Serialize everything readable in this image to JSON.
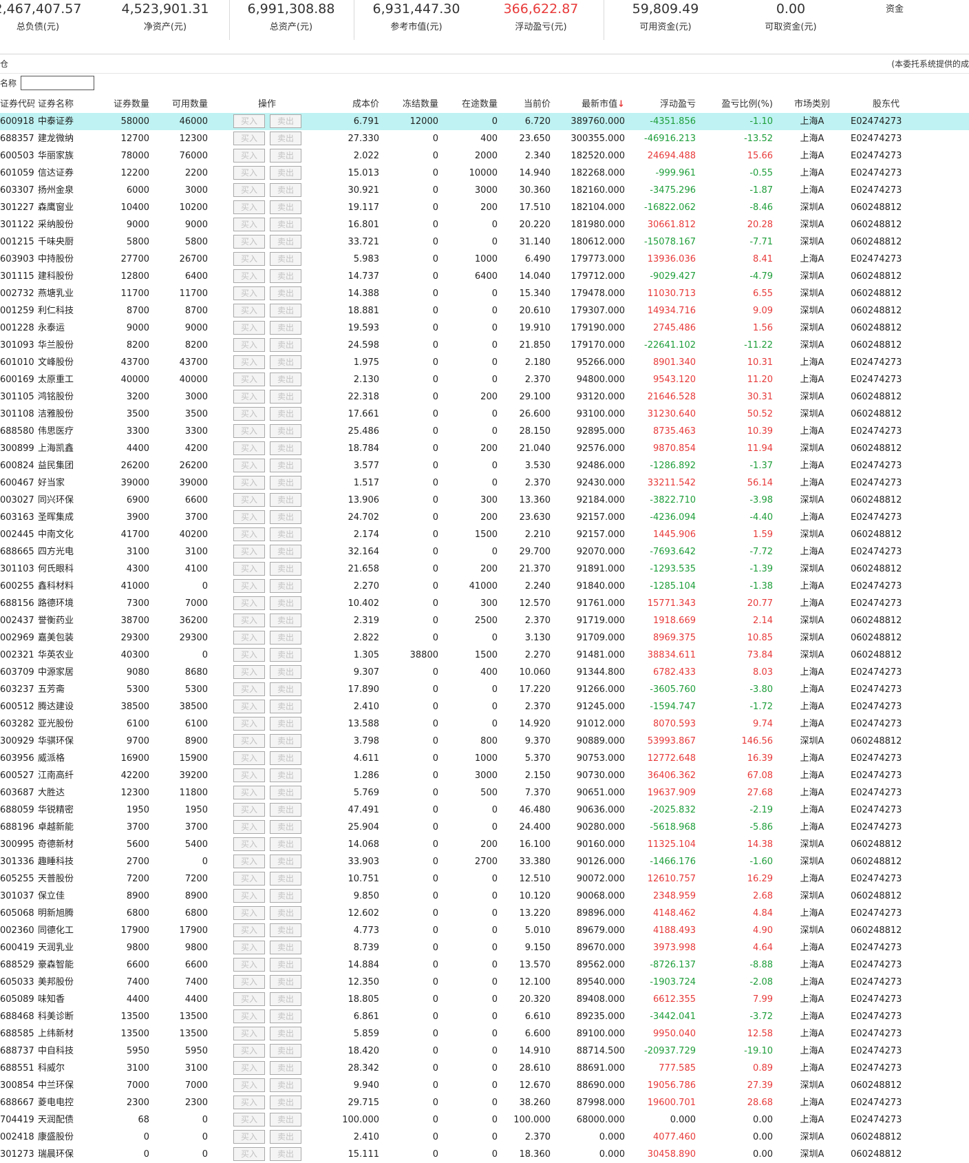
{
  "summary": [
    {
      "value": "2,467,407.57",
      "label": "总负债(元)",
      "highlight": false
    },
    {
      "value": "4,523,901.31",
      "label": "净资产(元)",
      "highlight": false
    },
    {
      "value": "6,991,308.88",
      "label": "总资产(元)",
      "highlight": false
    },
    {
      "value": "6,931,447.30",
      "label": "参考市值(元)",
      "highlight": false
    },
    {
      "value": "366,622.87",
      "label": "浮动盈亏(元)",
      "highlight": true
    },
    {
      "value": "59,809.49",
      "label": "可用资金(元)",
      "highlight": false
    },
    {
      "value": "0.00",
      "label": "可取资金(元)",
      "highlight": false
    },
    {
      "value": "",
      "label": "资金",
      "highlight": false
    }
  ],
  "toolbar": {
    "left_text": "仓",
    "right_text": "(本委托系统提供的成"
  },
  "filter": {
    "label": "名称",
    "value": ""
  },
  "columns": [
    "证券代码",
    "证券名称",
    "证券数量",
    "可用数量",
    "操作",
    "成本价",
    "冻结数量",
    "在途数量",
    "当前价",
    "最新市值",
    "浮动盈亏",
    "盈亏比例(%)",
    "市场类别",
    "股东代"
  ],
  "sort_arrow": "↓",
  "buy_label": "买入",
  "sell_label": "卖出",
  "colors": {
    "profit": "#e83a3a",
    "loss": "#1e9e3a",
    "selected": "#bff2f2"
  },
  "rows": [
    [
      "600918",
      "中泰证券",
      "58000",
      "46000",
      "6.791",
      "12000",
      "0",
      "6.720",
      "389760.000",
      "-4351.856",
      "-1.10",
      "上海A",
      "E02474273"
    ],
    [
      "688357",
      "建龙微纳",
      "12700",
      "12300",
      "27.330",
      "0",
      "400",
      "23.650",
      "300355.000",
      "-46916.213",
      "-13.52",
      "上海A",
      "E02474273"
    ],
    [
      "600503",
      "华丽家族",
      "78000",
      "76000",
      "2.022",
      "0",
      "2000",
      "2.340",
      "182520.000",
      "24694.488",
      "15.66",
      "上海A",
      "E02474273"
    ],
    [
      "601059",
      "信达证券",
      "12200",
      "2200",
      "15.013",
      "0",
      "10000",
      "14.940",
      "182268.000",
      "-999.961",
      "-0.55",
      "上海A",
      "E02474273"
    ],
    [
      "603307",
      "扬州金泉",
      "6000",
      "3000",
      "30.921",
      "0",
      "3000",
      "30.360",
      "182160.000",
      "-3475.296",
      "-1.87",
      "上海A",
      "E02474273"
    ],
    [
      "301227",
      "森鹰窗业",
      "10400",
      "10200",
      "19.117",
      "0",
      "200",
      "17.510",
      "182104.000",
      "-16822.062",
      "-8.46",
      "深圳A",
      "060248812"
    ],
    [
      "301122",
      "采纳股份",
      "9000",
      "9000",
      "16.801",
      "0",
      "0",
      "20.220",
      "181980.000",
      "30661.812",
      "20.28",
      "深圳A",
      "060248812"
    ],
    [
      "001215",
      "千味央厨",
      "5800",
      "5800",
      "33.721",
      "0",
      "0",
      "31.140",
      "180612.000",
      "-15078.167",
      "-7.71",
      "深圳A",
      "060248812"
    ],
    [
      "603903",
      "中持股份",
      "27700",
      "26700",
      "5.983",
      "0",
      "1000",
      "6.490",
      "179773.000",
      "13936.036",
      "8.41",
      "上海A",
      "E02474273"
    ],
    [
      "301115",
      "建科股份",
      "12800",
      "6400",
      "14.737",
      "0",
      "6400",
      "14.040",
      "179712.000",
      "-9029.427",
      "-4.79",
      "深圳A",
      "060248812"
    ],
    [
      "002732",
      "燕塘乳业",
      "11700",
      "11700",
      "14.388",
      "0",
      "0",
      "15.340",
      "179478.000",
      "11030.713",
      "6.55",
      "深圳A",
      "060248812"
    ],
    [
      "001259",
      "利仁科技",
      "8700",
      "8700",
      "18.881",
      "0",
      "0",
      "20.610",
      "179307.000",
      "14934.716",
      "9.09",
      "深圳A",
      "060248812"
    ],
    [
      "001228",
      "永泰运",
      "9000",
      "9000",
      "19.593",
      "0",
      "0",
      "19.910",
      "179190.000",
      "2745.486",
      "1.56",
      "深圳A",
      "060248812"
    ],
    [
      "301093",
      "华兰股份",
      "8200",
      "8200",
      "24.598",
      "0",
      "0",
      "21.850",
      "179170.000",
      "-22641.102",
      "-11.22",
      "深圳A",
      "060248812"
    ],
    [
      "601010",
      "文峰股份",
      "43700",
      "43700",
      "1.975",
      "0",
      "0",
      "2.180",
      "95266.000",
      "8901.340",
      "10.31",
      "上海A",
      "E02474273"
    ],
    [
      "600169",
      "太原重工",
      "40000",
      "40000",
      "2.130",
      "0",
      "0",
      "2.370",
      "94800.000",
      "9543.120",
      "11.20",
      "上海A",
      "E02474273"
    ],
    [
      "301105",
      "鸿铭股份",
      "3200",
      "3000",
      "22.318",
      "0",
      "200",
      "29.100",
      "93120.000",
      "21646.528",
      "30.31",
      "深圳A",
      "060248812"
    ],
    [
      "301108",
      "洁雅股份",
      "3500",
      "3500",
      "17.661",
      "0",
      "0",
      "26.600",
      "93100.000",
      "31230.640",
      "50.52",
      "深圳A",
      "060248812"
    ],
    [
      "688580",
      "伟思医疗",
      "3300",
      "3300",
      "25.486",
      "0",
      "0",
      "28.150",
      "92895.000",
      "8735.463",
      "10.39",
      "上海A",
      "E02474273"
    ],
    [
      "300899",
      "上海凯鑫",
      "4400",
      "4200",
      "18.784",
      "0",
      "200",
      "21.040",
      "92576.000",
      "9870.854",
      "11.94",
      "深圳A",
      "060248812"
    ],
    [
      "600824",
      "益民集团",
      "26200",
      "26200",
      "3.577",
      "0",
      "0",
      "3.530",
      "92486.000",
      "-1286.892",
      "-1.37",
      "上海A",
      "E02474273"
    ],
    [
      "600467",
      "好当家",
      "39000",
      "39000",
      "1.517",
      "0",
      "0",
      "2.370",
      "92430.000",
      "33211.542",
      "56.14",
      "上海A",
      "E02474273"
    ],
    [
      "003027",
      "同兴环保",
      "6900",
      "6600",
      "13.906",
      "0",
      "300",
      "13.360",
      "92184.000",
      "-3822.710",
      "-3.98",
      "深圳A",
      "060248812"
    ],
    [
      "603163",
      "圣晖集成",
      "3900",
      "3700",
      "24.702",
      "0",
      "200",
      "23.630",
      "92157.000",
      "-4236.094",
      "-4.40",
      "上海A",
      "E02474273"
    ],
    [
      "002445",
      "中南文化",
      "41700",
      "40200",
      "2.174",
      "0",
      "1500",
      "2.210",
      "92157.000",
      "1445.906",
      "1.59",
      "深圳A",
      "060248812"
    ],
    [
      "688665",
      "四方光电",
      "3100",
      "3100",
      "32.164",
      "0",
      "0",
      "29.700",
      "92070.000",
      "-7693.642",
      "-7.72",
      "上海A",
      "E02474273"
    ],
    [
      "301103",
      "何氏眼科",
      "4300",
      "4100",
      "21.658",
      "0",
      "200",
      "21.370",
      "91891.000",
      "-1293.535",
      "-1.39",
      "深圳A",
      "060248812"
    ],
    [
      "600255",
      "鑫科材料",
      "41000",
      "0",
      "2.270",
      "0",
      "41000",
      "2.240",
      "91840.000",
      "-1285.104",
      "-1.38",
      "上海A",
      "E02474273"
    ],
    [
      "688156",
      "路德环境",
      "7300",
      "7000",
      "10.402",
      "0",
      "300",
      "12.570",
      "91761.000",
      "15771.343",
      "20.77",
      "上海A",
      "E02474273"
    ],
    [
      "002437",
      "誉衡药业",
      "38700",
      "36200",
      "2.319",
      "0",
      "2500",
      "2.370",
      "91719.000",
      "1918.669",
      "2.14",
      "深圳A",
      "060248812"
    ],
    [
      "002969",
      "嘉美包装",
      "29300",
      "29300",
      "2.822",
      "0",
      "0",
      "3.130",
      "91709.000",
      "8969.375",
      "10.85",
      "深圳A",
      "060248812"
    ],
    [
      "002321",
      "华英农业",
      "40300",
      "0",
      "1.305",
      "38800",
      "1500",
      "2.270",
      "91481.000",
      "38834.611",
      "73.84",
      "深圳A",
      "060248812"
    ],
    [
      "603709",
      "中源家居",
      "9080",
      "8680",
      "9.307",
      "0",
      "400",
      "10.060",
      "91344.800",
      "6782.433",
      "8.03",
      "上海A",
      "E02474273"
    ],
    [
      "603237",
      "五芳斋",
      "5300",
      "5300",
      "17.890",
      "0",
      "0",
      "17.220",
      "91266.000",
      "-3605.760",
      "-3.80",
      "上海A",
      "E02474273"
    ],
    [
      "600512",
      "腾达建设",
      "38500",
      "38500",
      "2.410",
      "0",
      "0",
      "2.370",
      "91245.000",
      "-1594.747",
      "-1.72",
      "上海A",
      "E02474273"
    ],
    [
      "603282",
      "亚光股份",
      "6100",
      "6100",
      "13.588",
      "0",
      "0",
      "14.920",
      "91012.000",
      "8070.593",
      "9.74",
      "上海A",
      "E02474273"
    ],
    [
      "300929",
      "华骐环保",
      "9700",
      "8900",
      "3.798",
      "0",
      "800",
      "9.370",
      "90889.000",
      "53993.867",
      "146.56",
      "深圳A",
      "060248812"
    ],
    [
      "603956",
      "威派格",
      "16900",
      "15900",
      "4.611",
      "0",
      "1000",
      "5.370",
      "90753.000",
      "12772.648",
      "16.39",
      "上海A",
      "E02474273"
    ],
    [
      "600527",
      "江南高纤",
      "42200",
      "39200",
      "1.286",
      "0",
      "3000",
      "2.150",
      "90730.000",
      "36406.362",
      "67.08",
      "上海A",
      "E02474273"
    ],
    [
      "603687",
      "大胜达",
      "12300",
      "11800",
      "5.769",
      "0",
      "500",
      "7.370",
      "90651.000",
      "19637.909",
      "27.68",
      "上海A",
      "E02474273"
    ],
    [
      "688059",
      "华锐精密",
      "1950",
      "1950",
      "47.491",
      "0",
      "0",
      "46.480",
      "90636.000",
      "-2025.832",
      "-2.19",
      "上海A",
      "E02474273"
    ],
    [
      "688196",
      "卓越新能",
      "3700",
      "3700",
      "25.904",
      "0",
      "0",
      "24.400",
      "90280.000",
      "-5618.968",
      "-5.86",
      "上海A",
      "E02474273"
    ],
    [
      "300995",
      "奇德新材",
      "5600",
      "5400",
      "14.068",
      "0",
      "200",
      "16.100",
      "90160.000",
      "11325.104",
      "14.38",
      "深圳A",
      "060248812"
    ],
    [
      "301336",
      "趣睡科技",
      "2700",
      "0",
      "33.903",
      "0",
      "2700",
      "33.380",
      "90126.000",
      "-1466.176",
      "-1.60",
      "深圳A",
      "060248812"
    ],
    [
      "605255",
      "天普股份",
      "7200",
      "7200",
      "10.751",
      "0",
      "0",
      "12.510",
      "90072.000",
      "12610.757",
      "16.29",
      "上海A",
      "E02474273"
    ],
    [
      "301037",
      "保立佳",
      "8900",
      "8900",
      "9.850",
      "0",
      "0",
      "10.120",
      "90068.000",
      "2348.959",
      "2.68",
      "深圳A",
      "060248812"
    ],
    [
      "605068",
      "明新旭腾",
      "6800",
      "6800",
      "12.602",
      "0",
      "0",
      "13.220",
      "89896.000",
      "4148.462",
      "4.84",
      "上海A",
      "E02474273"
    ],
    [
      "002360",
      "同德化工",
      "17900",
      "17900",
      "4.773",
      "0",
      "0",
      "5.010",
      "89679.000",
      "4188.493",
      "4.90",
      "深圳A",
      "060248812"
    ],
    [
      "600419",
      "天润乳业",
      "9800",
      "9800",
      "8.739",
      "0",
      "0",
      "9.150",
      "89670.000",
      "3973.998",
      "4.64",
      "上海A",
      "E02474273"
    ],
    [
      "688529",
      "豪森智能",
      "6600",
      "6600",
      "14.884",
      "0",
      "0",
      "13.570",
      "89562.000",
      "-8726.137",
      "-8.88",
      "上海A",
      "E02474273"
    ],
    [
      "605033",
      "美邦股份",
      "7400",
      "7400",
      "12.350",
      "0",
      "0",
      "12.100",
      "89540.000",
      "-1903.724",
      "-2.08",
      "上海A",
      "E02474273"
    ],
    [
      "605089",
      "味知香",
      "4400",
      "4400",
      "18.805",
      "0",
      "0",
      "20.320",
      "89408.000",
      "6612.355",
      "7.99",
      "上海A",
      "E02474273"
    ],
    [
      "688468",
      "科美诊断",
      "13500",
      "13500",
      "6.861",
      "0",
      "0",
      "6.610",
      "89235.000",
      "-3442.041",
      "-3.72",
      "上海A",
      "E02474273"
    ],
    [
      "688585",
      "上纬新材",
      "13500",
      "13500",
      "5.859",
      "0",
      "0",
      "6.600",
      "89100.000",
      "9950.040",
      "12.58",
      "上海A",
      "E02474273"
    ],
    [
      "688737",
      "中自科技",
      "5950",
      "5950",
      "18.420",
      "0",
      "0",
      "14.910",
      "88714.500",
      "-20937.729",
      "-19.10",
      "上海A",
      "E02474273"
    ],
    [
      "688551",
      "科威尔",
      "3100",
      "3100",
      "28.342",
      "0",
      "0",
      "28.610",
      "88691.000",
      "777.585",
      "0.89",
      "上海A",
      "E02474273"
    ],
    [
      "300854",
      "中兰环保",
      "7000",
      "7000",
      "9.940",
      "0",
      "0",
      "12.670",
      "88690.000",
      "19056.786",
      "27.39",
      "深圳A",
      "060248812"
    ],
    [
      "688667",
      "菱电电控",
      "2300",
      "2300",
      "29.715",
      "0",
      "0",
      "38.260",
      "87998.000",
      "19600.701",
      "28.68",
      "上海A",
      "E02474273"
    ],
    [
      "704419",
      "天润配债",
      "68",
      "0",
      "100.000",
      "0",
      "0",
      "100.000",
      "68000.000",
      "0.000",
      "0.00",
      "上海A",
      "E02474273"
    ],
    [
      "002418",
      "康盛股份",
      "0",
      "0",
      "2.410",
      "0",
      "0",
      "2.370",
      "0.000",
      "4077.460",
      "0.00",
      "深圳A",
      "060248812"
    ],
    [
      "301273",
      "瑞晨环保",
      "0",
      "0",
      "15.111",
      "0",
      "0",
      "18.360",
      "0.000",
      "30458.890",
      "0.00",
      "深圳A",
      "060248812"
    ]
  ]
}
